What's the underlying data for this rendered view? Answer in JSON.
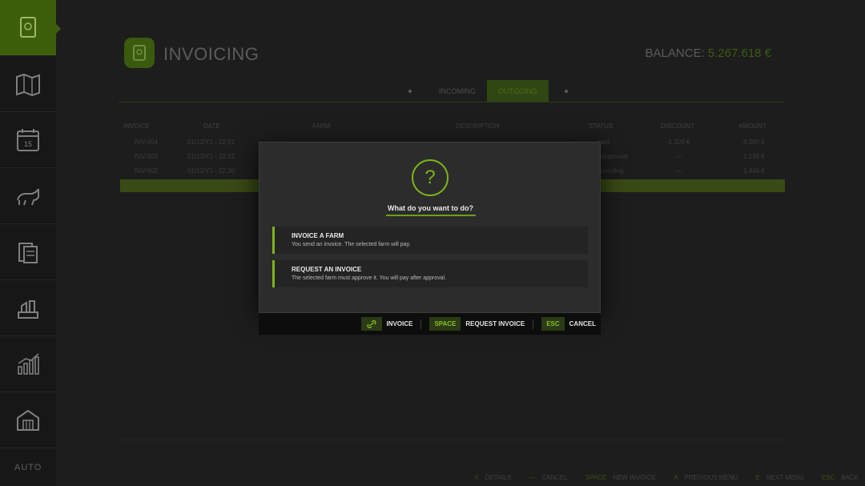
{
  "sidebar": {
    "items": [
      {
        "icon": "invoice-icon",
        "active": true
      },
      {
        "icon": "map-icon",
        "active": false
      },
      {
        "icon": "calendar-icon",
        "active": false,
        "calendar_number": "15"
      },
      {
        "icon": "animals-icon",
        "active": false
      },
      {
        "icon": "contracts-icon",
        "active": false
      },
      {
        "icon": "production-icon",
        "active": false
      },
      {
        "icon": "statistics-icon",
        "active": false
      },
      {
        "icon": "buildings-icon",
        "active": false
      }
    ],
    "more_label": "AUTO"
  },
  "header": {
    "title": "INVOICING",
    "balance_label": "BALANCE:",
    "balance_value": "5.267.618 €"
  },
  "tabs": [
    {
      "label": "INCOMING",
      "active": false
    },
    {
      "label": "OUTGOING",
      "active": true
    }
  ],
  "table": {
    "columns": [
      "INVOICE",
      "DATE",
      "FARM",
      "DESCRIPTION",
      "STATUS",
      "DISCOUNT",
      "AMOUNT"
    ],
    "rows": [
      {
        "invoice": "INV-004",
        "date": "01/12/Y1 - 22:31",
        "farm": "",
        "description": "",
        "status": "paid",
        "discount": "-1.320 €",
        "amount": "8.280 €",
        "selected": false
      },
      {
        "invoice": "INV-003",
        "date": "01/12/Y1 - 22:31",
        "farm": "",
        "description": "",
        "status": "approved",
        "discount": "—",
        "amount": "2.138 €",
        "selected": false
      },
      {
        "invoice": "INV-002",
        "date": "01/12/Y1 - 22:30",
        "farm": "",
        "description": "",
        "status": "pending",
        "discount": "—",
        "amount": "1.440 €",
        "selected": false
      },
      {
        "invoice": "",
        "date": "",
        "farm": "",
        "description": "",
        "status": "",
        "discount": "",
        "amount": "",
        "selected": true
      }
    ]
  },
  "modal": {
    "icon": "question-icon",
    "icon_glyph": "?",
    "title": "What do you want to do?",
    "options": [
      {
        "title": "INVOICE A FARM",
        "description": "You send an invoice. The selected farm will pay."
      },
      {
        "title": "REQUEST AN INVOICE",
        "description": "The selected farm must approve it. You will pay after approval."
      }
    ],
    "actions": [
      {
        "key": "",
        "key_icon": "link-icon",
        "label": "INVOICE"
      },
      {
        "key": "SPACE",
        "label": "REQUEST INVOICE"
      },
      {
        "key": "ESC",
        "label": "CANCEL"
      }
    ]
  },
  "footer": {
    "actions": [
      {
        "key": "X",
        "label": "DETAILS"
      },
      {
        "key": "—",
        "label": "CANCEL"
      },
      {
        "key": "SPACE",
        "label": "NEW INVOICE"
      },
      {
        "key": "A",
        "label": "PREVIOUS MENU"
      },
      {
        "key": "E",
        "label": "NEXT MENU"
      },
      {
        "key": "ESC",
        "label": "BACK"
      }
    ]
  },
  "colors": {
    "accent": "#7cb31b",
    "background": "#1c1d1c",
    "modal": "#2b2c2b"
  }
}
